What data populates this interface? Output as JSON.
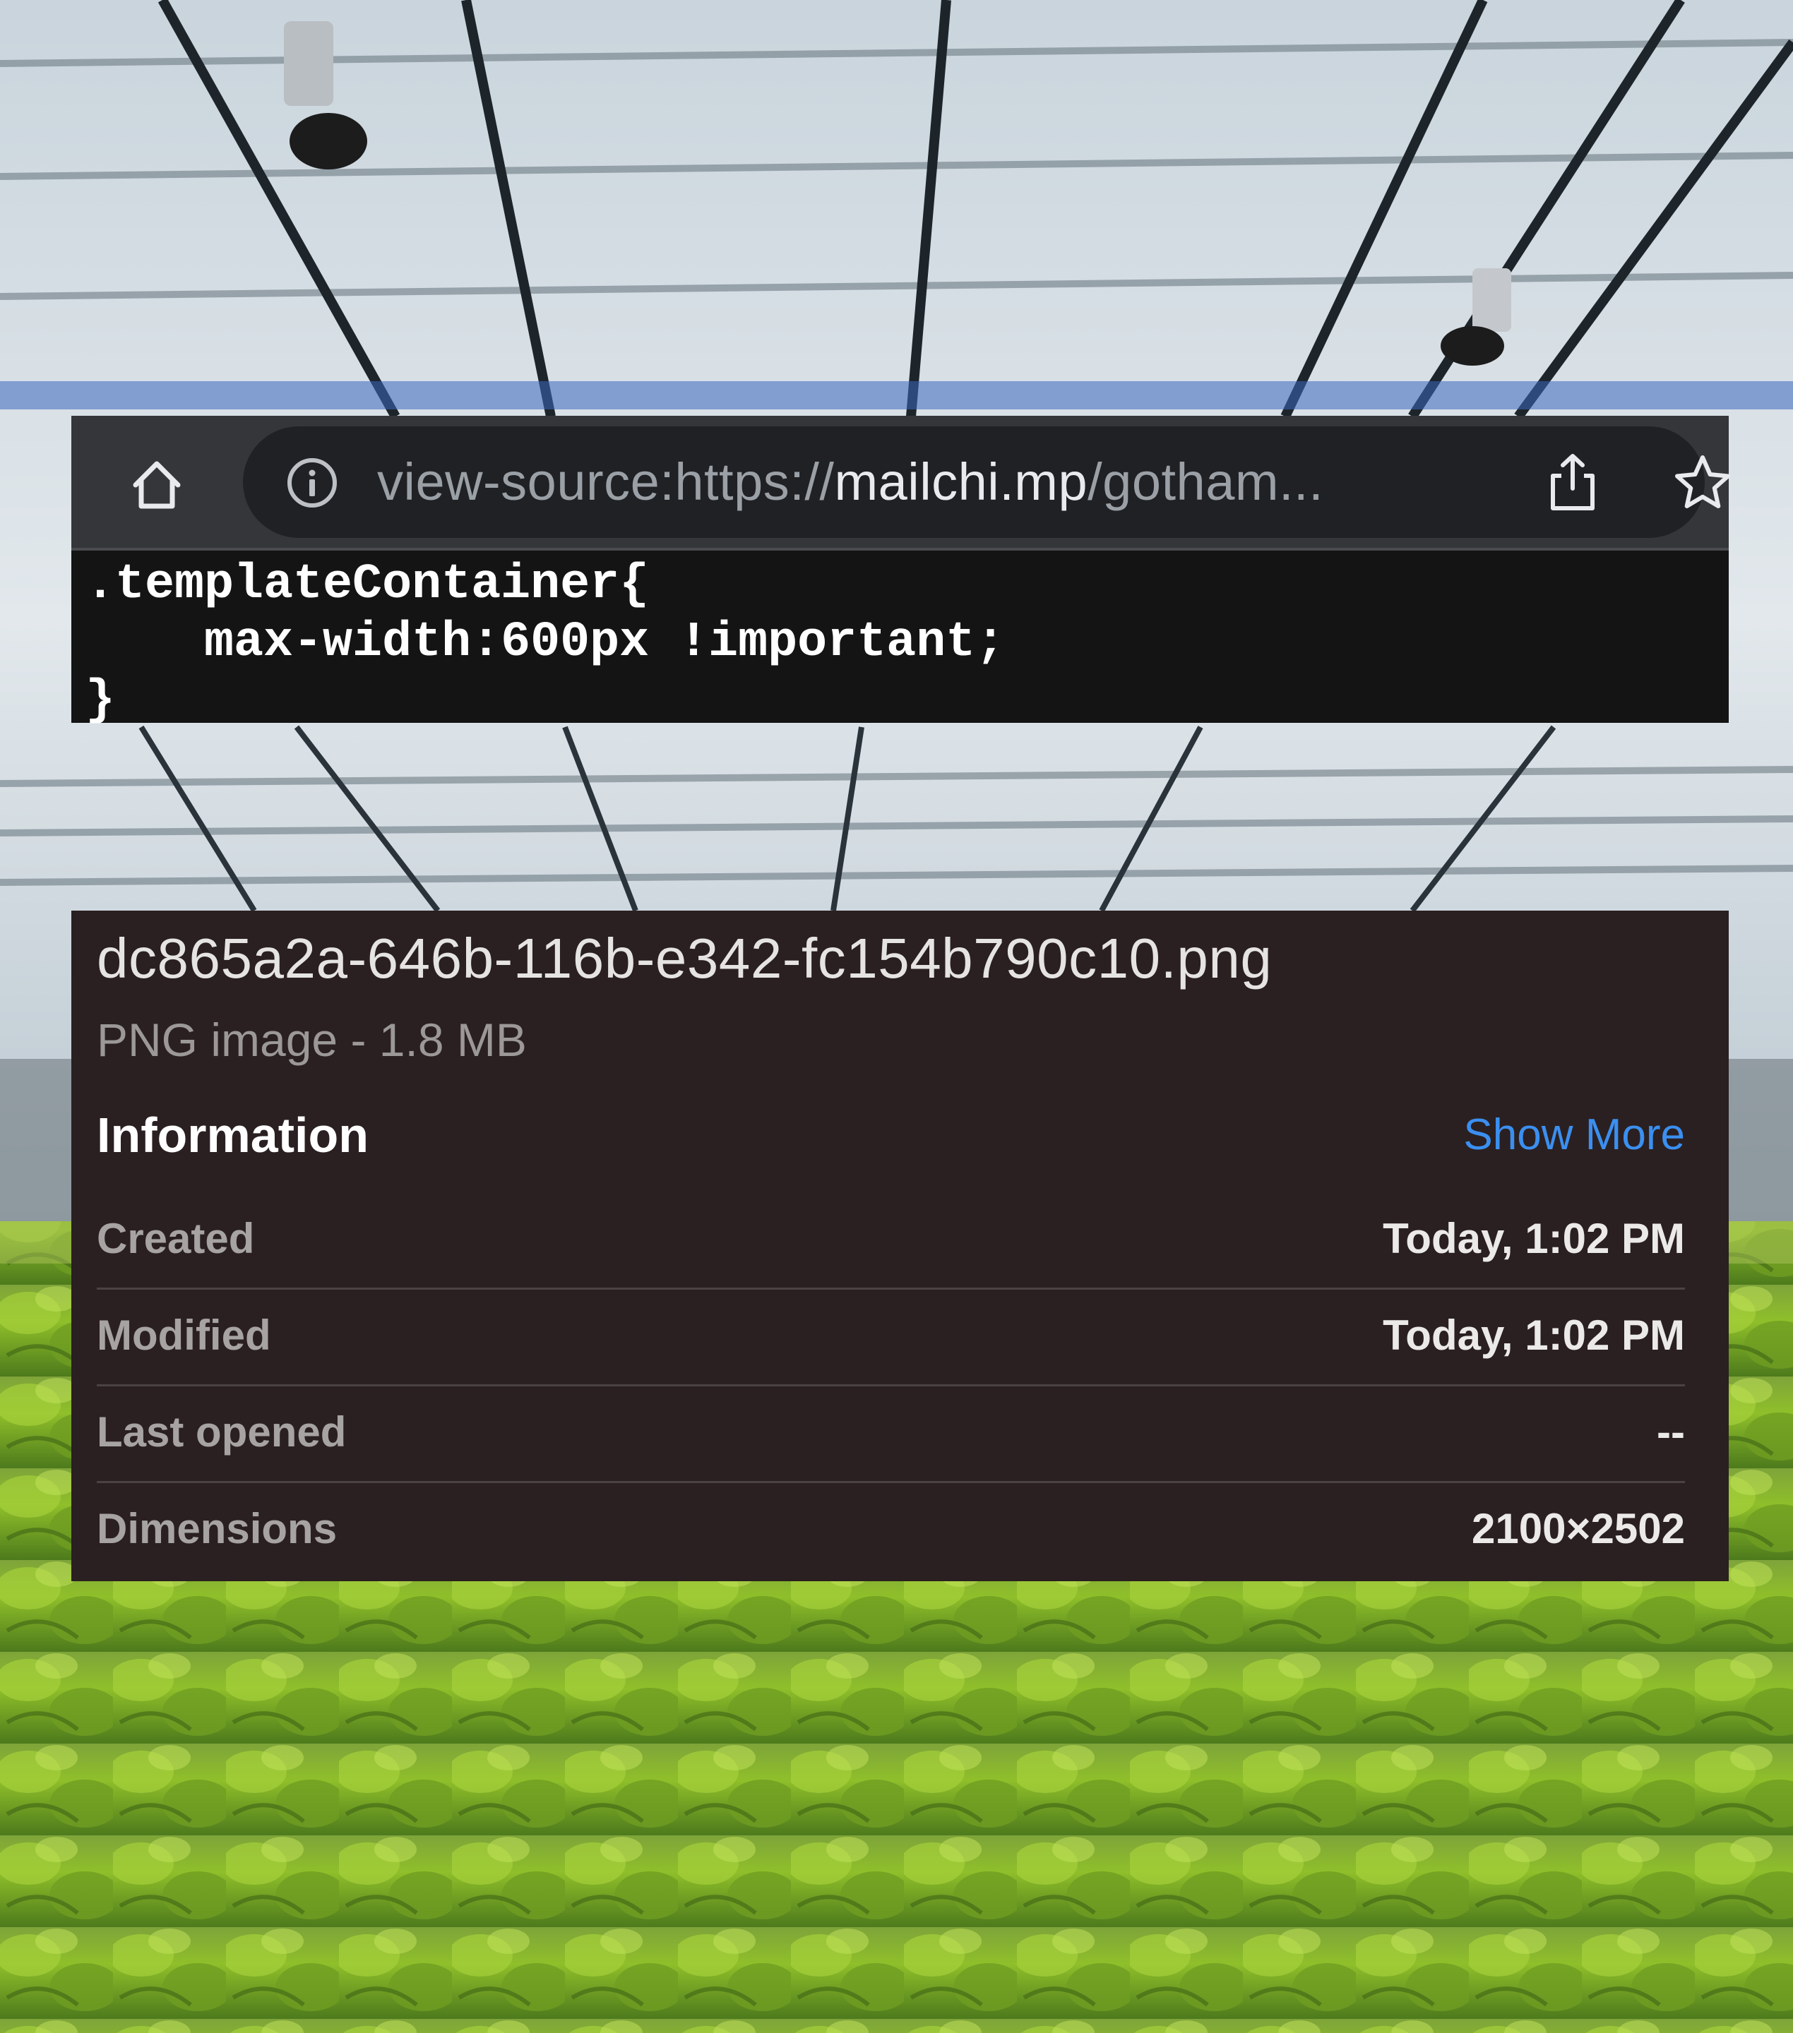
{
  "browser": {
    "url_prefix": "view-source:https://",
    "url_host": "mailchi.mp",
    "url_path": "/gotham..."
  },
  "icons": {
    "home": "home-icon",
    "info": "info-icon",
    "share": "share-icon",
    "bookmark": "star-icon"
  },
  "code": {
    "lines": [
      ".templateContainer{",
      "    max-width:600px !important;",
      "}"
    ]
  },
  "file": {
    "name": "dc865a2a-646b-116b-e342-fc154b790c10.png",
    "type_size": "PNG image - 1.8 MB",
    "section_title": "Information",
    "show_more": "Show More",
    "rows": [
      {
        "label": "Created",
        "value": "Today, 1:02 PM"
      },
      {
        "label": "Modified",
        "value": "Today, 1:02 PM"
      },
      {
        "label": "Last opened",
        "value": "--"
      },
      {
        "label": "Dimensions",
        "value": "2100×2502"
      }
    ]
  },
  "colors": {
    "link": "#3b8ff0",
    "panel": "#2a2021",
    "browser_bar": "#35363a"
  }
}
